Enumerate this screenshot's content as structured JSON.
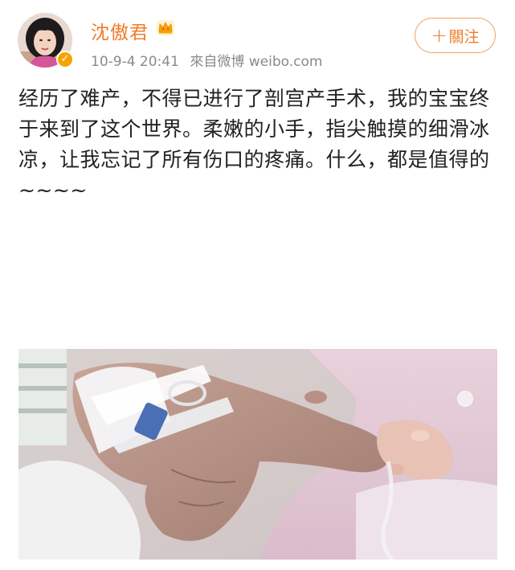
{
  "user": {
    "name": "沈傲君",
    "crown_icon": "crown-icon",
    "verified_icon": "verified-badge-icon",
    "accent_color": "#f07c2b"
  },
  "post": {
    "timestamp": "10-9-4 20:41",
    "source": "來自微博 weibo.com",
    "text": "经历了难产，不得已进行了剖宫产手术，我的宝宝终于来到了这个世界。柔嫩的小手，指尖触摸的细滑冰凉，让我忘记了所有伤口的疼痛。什么，都是值得的 ~~~~"
  },
  "follow_button": {
    "icon": "plus-icon",
    "plus": "+",
    "label": "關注"
  },
  "photo": {
    "subject": "adult hand with IV tape holding a baby's hand"
  }
}
